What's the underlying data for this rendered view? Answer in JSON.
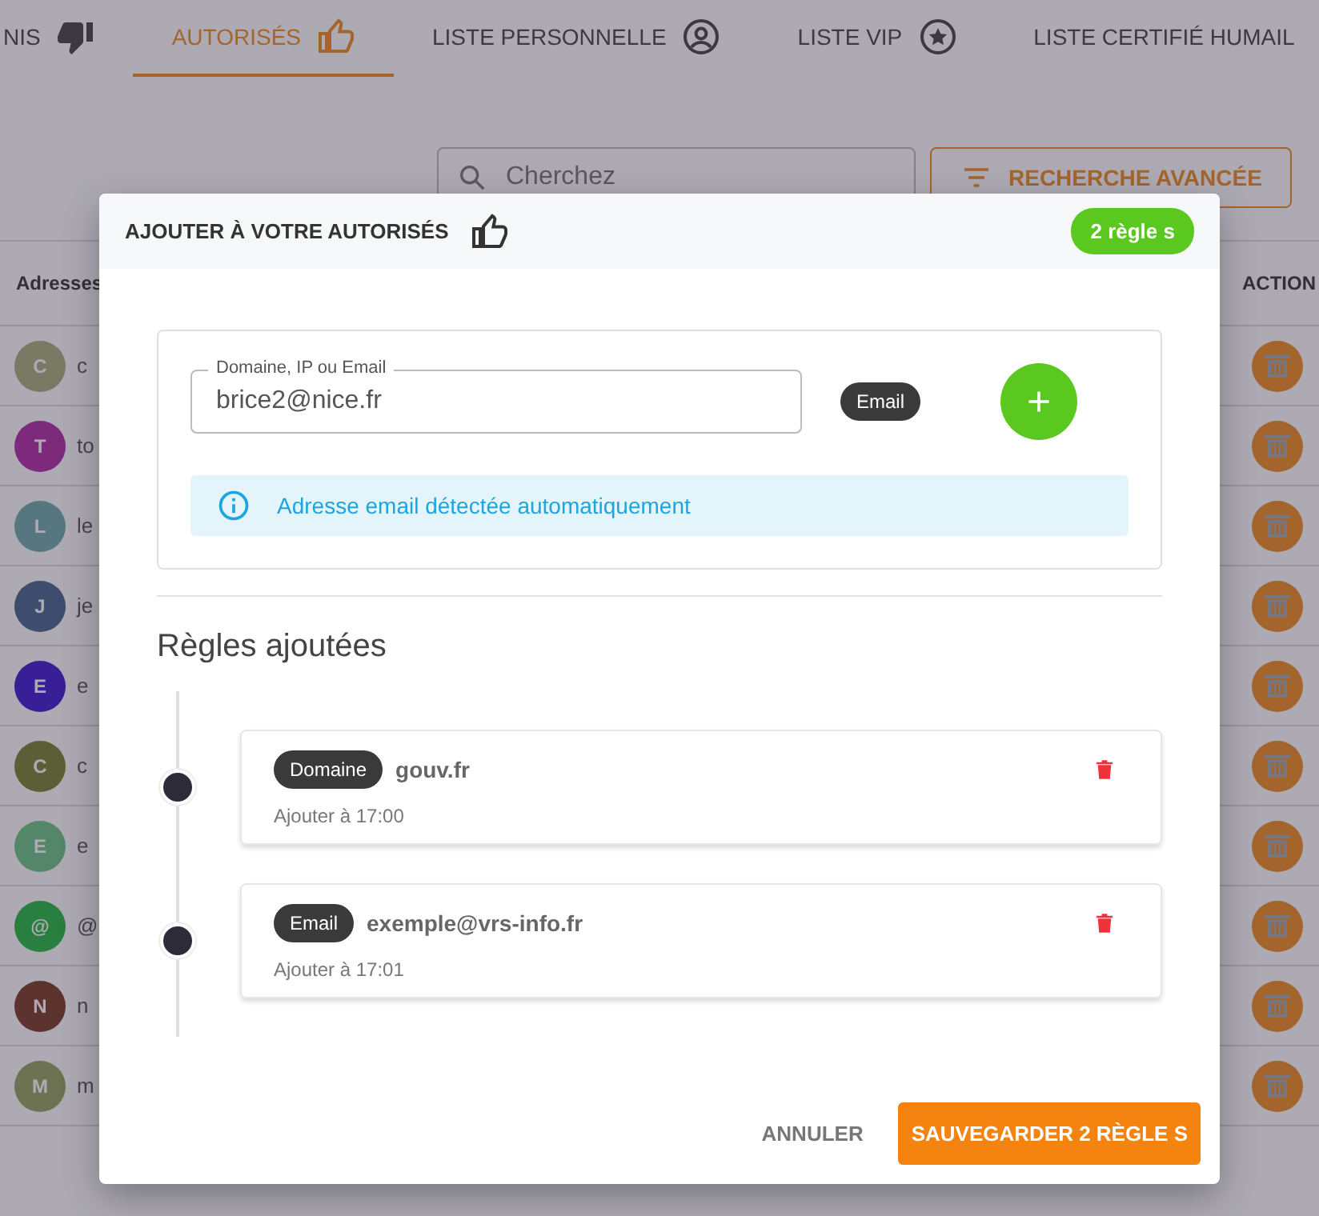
{
  "tabs": [
    {
      "label": "NIS",
      "selected": false
    },
    {
      "label": "AUTORISÉS",
      "selected": true
    },
    {
      "label": "LISTE PERSONNELLE",
      "selected": false
    },
    {
      "label": "LISTE VIP",
      "selected": false
    },
    {
      "label": "LISTE CERTIFIÉ HUMAIL",
      "selected": false
    }
  ],
  "search": {
    "placeholder": "Cherchez"
  },
  "advanced_search_button": "RECHERCHE AVANCÉE",
  "table": {
    "columns": [
      "Adresses",
      "ACTION"
    ],
    "rows": [
      {
        "initial": "C",
        "address": "c"
      },
      {
        "initial": "T",
        "address": "to"
      },
      {
        "initial": "L",
        "address": "le"
      },
      {
        "initial": "J",
        "address": "je"
      },
      {
        "initial": "E",
        "address": "e"
      },
      {
        "initial": "C",
        "address": "c"
      },
      {
        "initial": "E",
        "address": "e"
      },
      {
        "initial": "@",
        "address": "@"
      },
      {
        "initial": "N",
        "address": "n"
      },
      {
        "initial": "M",
        "address": "m"
      }
    ]
  },
  "dialog": {
    "title": "AJOUTER À VOTRE AUTORISÉS",
    "rule_count": "2 règle s",
    "field": {
      "label": "Domaine, IP ou Email",
      "value": "brice2@nice.fr"
    },
    "detected_type": "Email",
    "info": "Adresse email détectée automatiquement",
    "rules_heading": "Règles ajoutées",
    "rules": [
      {
        "type": "Domaine",
        "value": "gouv.fr",
        "time": "Ajouter à 17:00"
      },
      {
        "type": "Email",
        "value": "exemple@vrs-info.fr",
        "time": "Ajouter à 17:01"
      }
    ],
    "cancel_button": "ANNULER",
    "save_button": "SAUVEGARDER 2 RÈGLE S"
  }
}
